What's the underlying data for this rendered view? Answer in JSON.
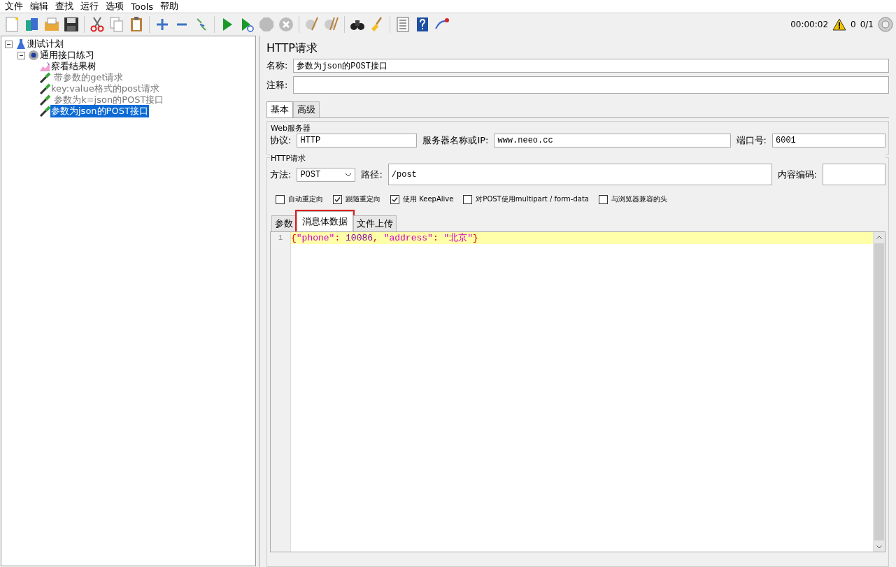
{
  "menu": [
    "文件",
    "编辑",
    "查找",
    "运行",
    "选项",
    "Tools",
    "帮助"
  ],
  "status": {
    "time": "00:00:02",
    "warnings": "0",
    "threads": "0/1"
  },
  "tree": [
    {
      "label": "测试计划",
      "kind": "plan",
      "expanded": true,
      "selected": false,
      "disabled": false,
      "children": [
        {
          "label": "通用接口练习",
          "kind": "group",
          "expanded": true,
          "selected": false,
          "disabled": false,
          "children": [
            {
              "label": "察看结果树",
              "kind": "listener",
              "selected": false,
              "disabled": false
            },
            {
              "label": " 带参数的get请求",
              "kind": "sampler",
              "selected": false,
              "disabled": true
            },
            {
              "label": "key:value格式的post请求",
              "kind": "sampler",
              "selected": false,
              "disabled": true
            },
            {
              "label": " 参数为k=json的POST接口",
              "kind": "sampler",
              "selected": false,
              "disabled": true
            },
            {
              "label": "参数为json的POST接口",
              "kind": "sampler",
              "selected": true,
              "disabled": false
            }
          ]
        }
      ]
    }
  ],
  "panel": {
    "title": "HTTP请求",
    "name_label": "名称:",
    "name_value": "参数为json的POST接口",
    "comment_label": "注释:"
  },
  "tabs": [
    {
      "label": "基本",
      "selected": true
    },
    {
      "label": "高级",
      "selected": false
    }
  ],
  "web_server": {
    "legend": "Web服务器",
    "protocol_label": "协议:",
    "protocol": "HTTP",
    "server_label": "服务器名称或IP:",
    "server": "www.neeo.cc",
    "port_label": "端口号:",
    "port": "6001"
  },
  "http_request": {
    "legend": "HTTP请求",
    "method_label": "方法:",
    "method": "POST",
    "path_label": "路径:",
    "path": "/post",
    "encoding_label": "内容编码:"
  },
  "options": [
    {
      "label": "自动重定向",
      "checked": false
    },
    {
      "label": "跟随重定向",
      "checked": true
    },
    {
      "label": "使用 KeepAlive",
      "checked": true
    },
    {
      "label": "对POST使用multipart / form-data",
      "checked": false
    },
    {
      "label": "与浏览器兼容的头",
      "checked": false
    }
  ],
  "body_tabs": [
    {
      "label": "参数",
      "selected": false,
      "highlighted": false
    },
    {
      "label": "消息体数据",
      "selected": true,
      "highlighted": true
    },
    {
      "label": "文件上传",
      "selected": false,
      "highlighted": false
    }
  ],
  "editor": {
    "lines": [
      {
        "number": "1",
        "tokens": [
          {
            "kind": "punct",
            "text": "{"
          },
          {
            "kind": "string",
            "text": "\"phone\""
          },
          {
            "kind": "punct",
            "text": ": "
          },
          {
            "kind": "number",
            "text": "10086"
          },
          {
            "kind": "punct",
            "text": ", "
          },
          {
            "kind": "string",
            "text": "\"address\""
          },
          {
            "kind": "punct",
            "text": ": "
          },
          {
            "kind": "string",
            "text": "\"北京\""
          },
          {
            "kind": "punct",
            "text": "}"
          }
        ]
      }
    ]
  }
}
